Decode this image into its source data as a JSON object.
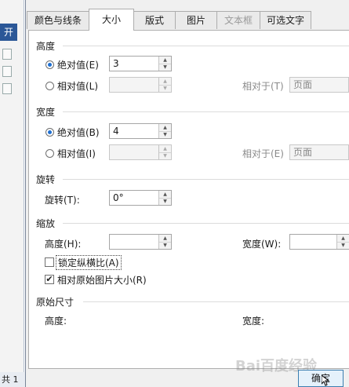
{
  "app": {
    "ribbon_tab": "开",
    "status_text": "共 1"
  },
  "tabs": [
    {
      "label": "颜色与线条",
      "state": "normal"
    },
    {
      "label": "大小",
      "state": "active"
    },
    {
      "label": "版式",
      "state": "normal"
    },
    {
      "label": "图片",
      "state": "normal"
    },
    {
      "label": "文本框",
      "state": "disabled"
    },
    {
      "label": "可选文字",
      "state": "normal"
    }
  ],
  "height": {
    "title": "高度",
    "absolute_label": "绝对值(E)",
    "absolute_value": "3",
    "absolute_selected": true,
    "relative_label": "相对值(L)",
    "relative_value": "",
    "relative_to_label": "相对于(T)",
    "relative_to_value": "页面"
  },
  "width": {
    "title": "宽度",
    "absolute_label": "绝对值(B)",
    "absolute_value": "4",
    "absolute_selected": true,
    "relative_label": "相对值(I)",
    "relative_value": "",
    "relative_to_label": "相对于(E)",
    "relative_to_value": "页面"
  },
  "rotation": {
    "title": "旋转",
    "label": "旋转(T):",
    "value": "0°"
  },
  "scale": {
    "title": "缩放",
    "height_label": "高度(H):",
    "height_value": "",
    "width_label": "宽度(W):",
    "width_value": "",
    "lock_aspect_label": "锁定纵横比(A)",
    "lock_aspect_checked": false,
    "relative_original_label": "相对原始图片大小(R)",
    "relative_original_checked": true
  },
  "original": {
    "title": "原始尺寸",
    "height_label": "高度:",
    "width_label": "宽度:"
  },
  "buttons": {
    "ok_label": "确定"
  },
  "watermark": "Bai百度经验",
  "colors": {
    "accent": "#1f6fd1",
    "border": "#adadad",
    "dialog_bg": "#f0f0f0"
  }
}
